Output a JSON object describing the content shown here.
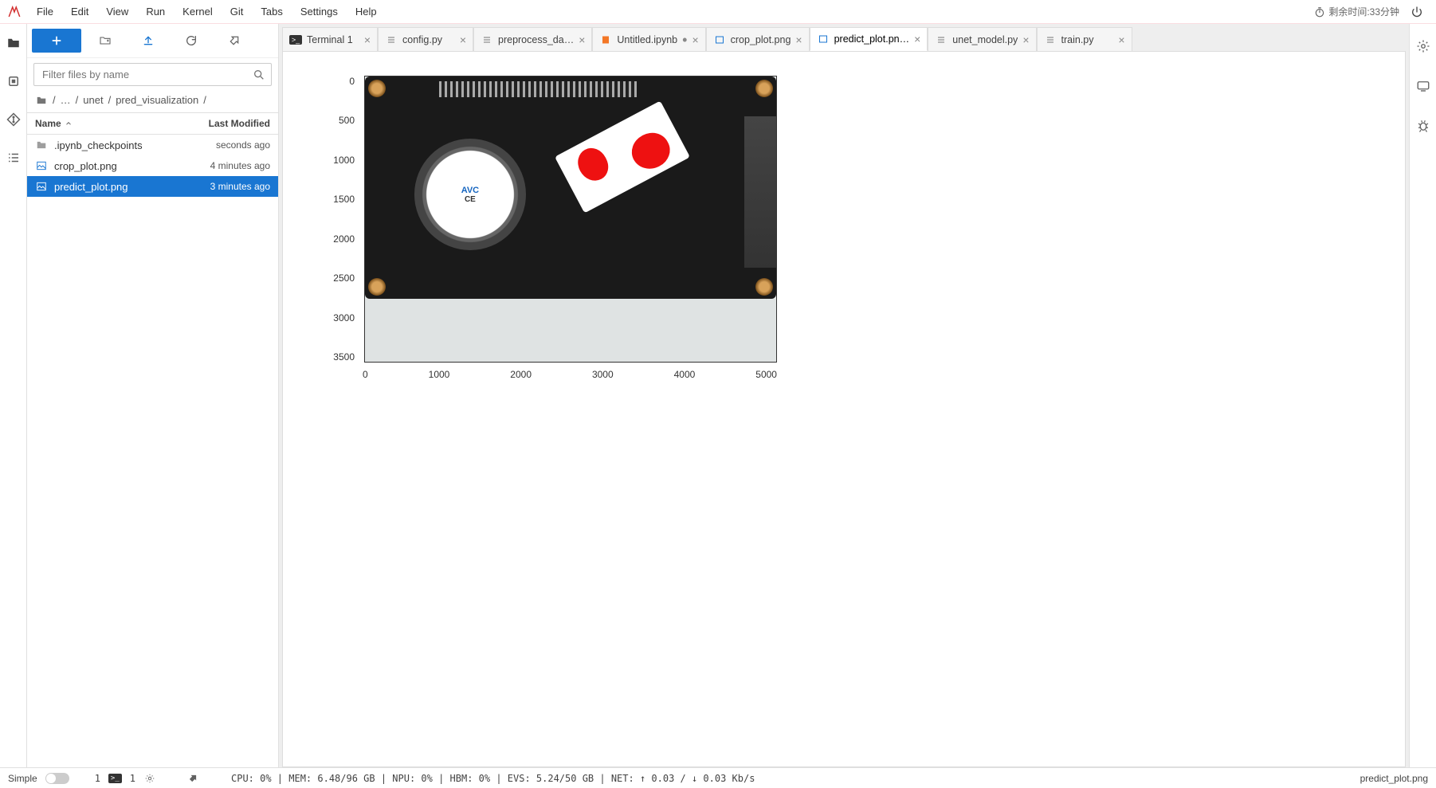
{
  "menu": {
    "items": [
      "File",
      "Edit",
      "View",
      "Run",
      "Kernel",
      "Git",
      "Tabs",
      "Settings",
      "Help"
    ],
    "time_remaining": "剩余时间:33分钟"
  },
  "toolbar": {
    "filter_placeholder": "Filter files by name"
  },
  "breadcrumb": {
    "parts": [
      "",
      "…",
      "unet",
      "pred_visualization",
      ""
    ]
  },
  "file_table": {
    "col_name": "Name",
    "col_modified": "Last Modified",
    "rows": [
      {
        "icon": "folder",
        "name": ".ipynb_checkpoints",
        "modified": "seconds ago",
        "selected": false
      },
      {
        "icon": "image",
        "name": "crop_plot.png",
        "modified": "4 minutes ago",
        "selected": false
      },
      {
        "icon": "image",
        "name": "predict_plot.png",
        "modified": "3 minutes ago",
        "selected": true
      }
    ]
  },
  "tabs": [
    {
      "icon": "terminal",
      "label": "Terminal 1",
      "active": false
    },
    {
      "icon": "py",
      "label": "config.py",
      "active": false
    },
    {
      "icon": "py",
      "label": "preprocess_da…",
      "active": false
    },
    {
      "icon": "nb",
      "label": "Untitled.ipynb",
      "active": false,
      "dirty": true
    },
    {
      "icon": "image",
      "label": "crop_plot.png",
      "active": false
    },
    {
      "icon": "image",
      "label": "predict_plot.pn…",
      "active": true
    },
    {
      "icon": "py",
      "label": "unet_model.py",
      "active": false
    },
    {
      "icon": "py",
      "label": "train.py",
      "active": false
    }
  ],
  "chart_data": {
    "type": "image-with-axes",
    "x_ticks": [
      "0",
      "1000",
      "2000",
      "3000",
      "4000",
      "5000"
    ],
    "y_ticks": [
      "0",
      "500",
      "1000",
      "1500",
      "2000",
      "2500",
      "3000",
      "3500"
    ],
    "xlim": [
      0,
      5000
    ],
    "ylim": [
      0,
      3700
    ],
    "fan_label_brand": "AVC",
    "fan_label_cert": "CE",
    "description": "Photograph of a black single-board computer (dev board) with a white AVC blower fan on the left, connector header pins along the top edge, ports on the right edge, four corner screws, and a white rotated sticker in the center-right bearing two red segmentation blobs (model prediction overlay)."
  },
  "status": {
    "mode": "Simple",
    "left_counts": {
      "notebooks": "1",
      "terminals": "1"
    },
    "metrics": "CPU: 0% | MEM: 6.48/96 GB | NPU: 0% | HBM: 0% | EVS: 5.24/50 GB | NET: ↑ 0.03 / ↓ 0.03 Kb/s",
    "filename": "predict_plot.png"
  }
}
